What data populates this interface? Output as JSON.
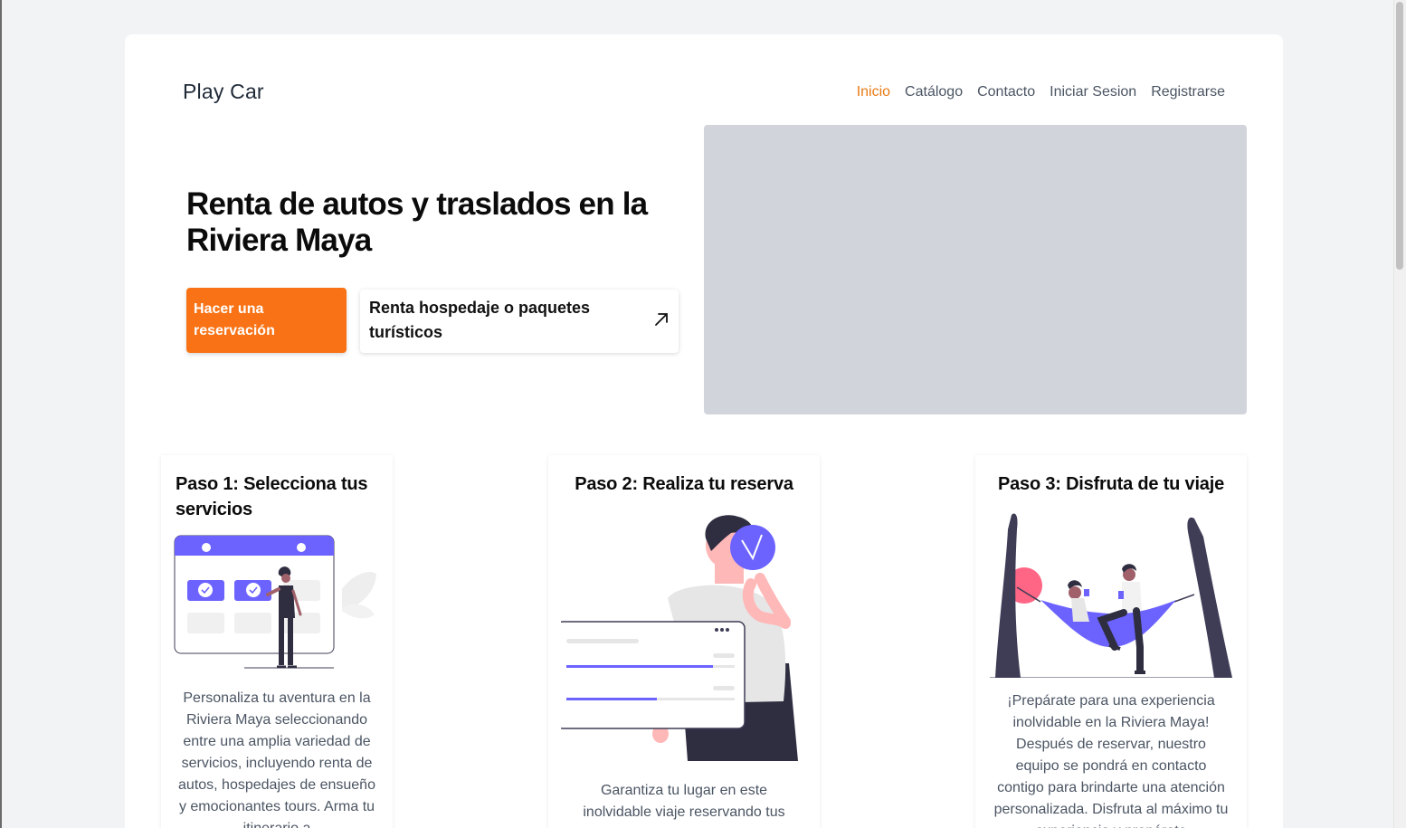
{
  "brand": {
    "name": "Play Car"
  },
  "nav": {
    "items": [
      {
        "label": "Inicio",
        "active": true
      },
      {
        "label": "Catálogo",
        "active": false
      },
      {
        "label": "Contacto",
        "active": false
      },
      {
        "label": "Iniciar Sesion",
        "active": false
      },
      {
        "label": "Registrarse",
        "active": false
      }
    ]
  },
  "hero": {
    "title": "Renta de autos y traslados en la Riviera Maya",
    "primary_button": "Hacer una reservación",
    "secondary_button": "Renta hospedaje o paquetes turísticos",
    "secondary_icon": "arrow-up-right-icon"
  },
  "steps": [
    {
      "title": "Paso 1: Selecciona tus servicios",
      "text": "Personaliza tu aventura en la Riviera Maya seleccionando entre una amplia variedad de servicios, incluyendo renta de autos, hospedajes de ensueño y emocionantes tours. Arma tu itinerario a",
      "illustration": "calendar-selection-illustration"
    },
    {
      "title": "Paso 2: Realiza tu reserva",
      "text": "Garantiza tu lugar en este inolvidable viaje reservando tus",
      "illustration": "confirmed-reservation-illustration"
    },
    {
      "title": "Paso 3: Disfruta de tu viaje",
      "text": "¡Prepárate para una experiencia inolvidable en la Riviera Maya! Después de reservar, nuestro equipo se pondrá en contacto contigo para brindarte una atención personalizada. Disfruta al máximo tu experiencia y prepárate",
      "illustration": "hammock-relax-illustration"
    }
  ],
  "colors": {
    "accent": "#f97316",
    "nav_active": "#ea7a12",
    "illustration_primary": "#6c63ff",
    "illustration_dark": "#2f2e41",
    "media_placeholder": "#d1d5db",
    "page_background": "#f2f3f5"
  }
}
